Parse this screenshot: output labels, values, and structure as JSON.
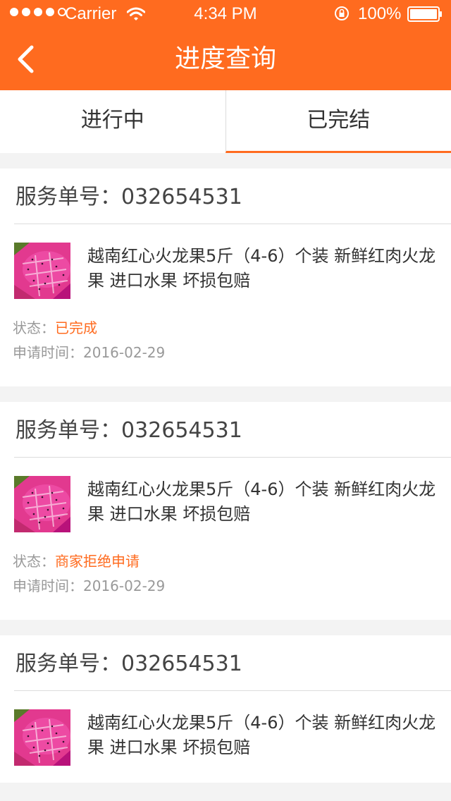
{
  "status_bar": {
    "carrier": "Carrier",
    "time": "4:34 PM",
    "battery": "100%",
    "signal_dots_filled": 4,
    "signal_dots_total": 5
  },
  "nav": {
    "title": "进度查询",
    "back_icon": "chevron-left-icon"
  },
  "tabs": [
    {
      "label": "进行中",
      "active": false
    },
    {
      "label": "已完结",
      "active": true
    }
  ],
  "orders": [
    {
      "order_label": "服务单号：032654531",
      "product_name": "越南红心火龙果5斤（4-6）个装 新鲜红肉火龙果 进口水果 坏损包赔",
      "status_label": "状态：",
      "status_value": "已完成",
      "apply_time": "申请时间：2016-02-29"
    },
    {
      "order_label": "服务单号：032654531",
      "product_name": "越南红心火龙果5斤（4-6）个装 新鲜红肉火龙果 进口水果 坏损包赔",
      "status_label": "状态：",
      "status_value": "商家拒绝申请",
      "apply_time": "申请时间：2016-02-29"
    },
    {
      "order_label": "服务单号：032654531",
      "product_name": "越南红心火龙果5斤（4-6）个装 新鲜红肉火龙果 进口水果 坏损包赔"
    }
  ],
  "colors": {
    "accent": "#ff6b1f",
    "background": "#f3f3f3",
    "text_primary": "#333333",
    "text_secondary": "#999999"
  }
}
